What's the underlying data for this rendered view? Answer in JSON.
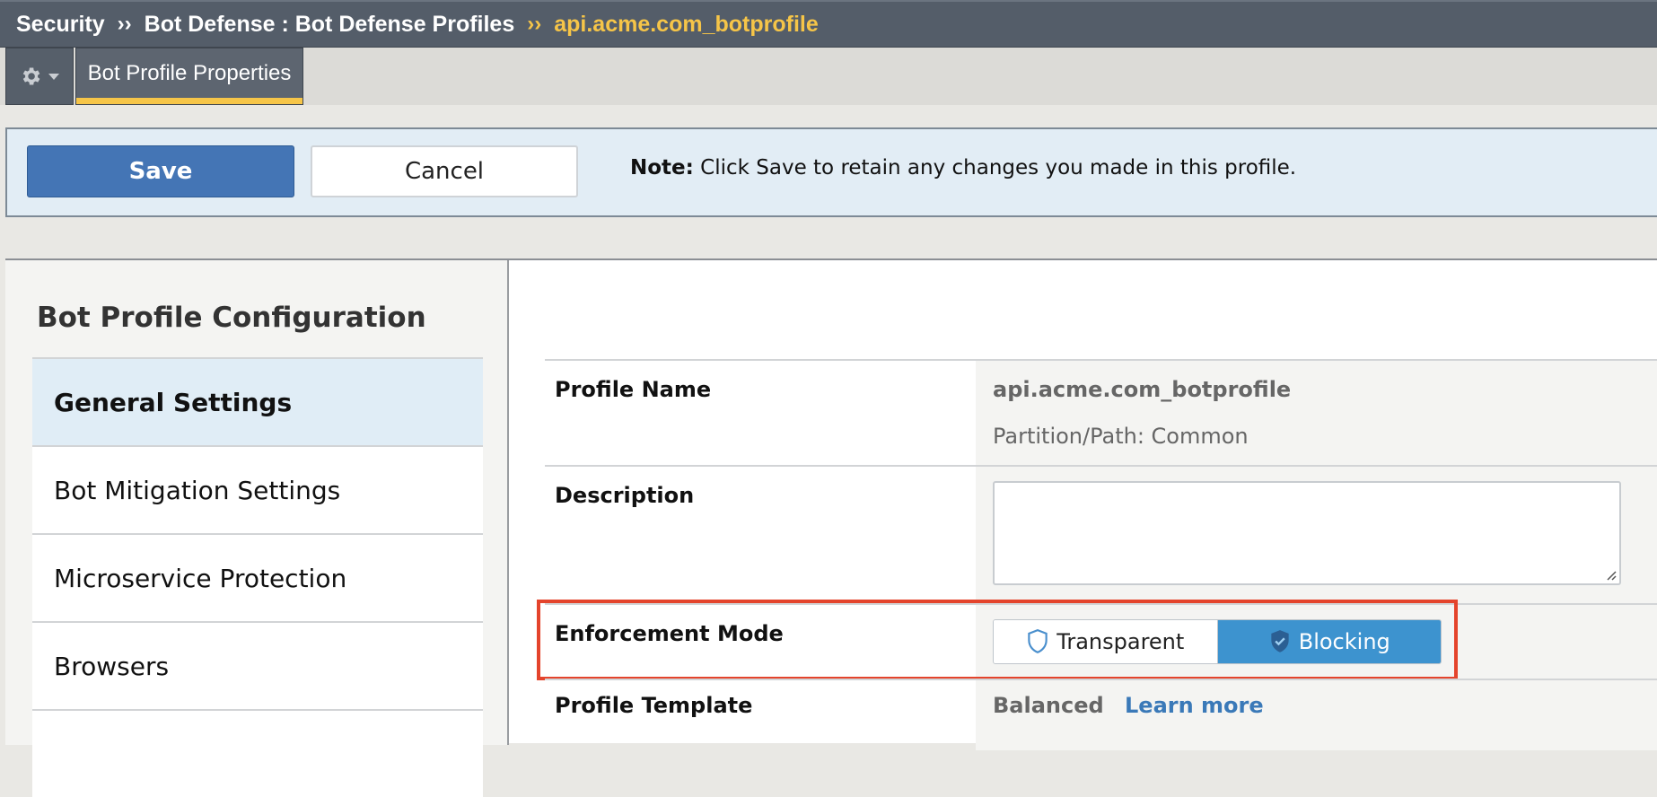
{
  "breadcrumb": {
    "items": [
      "Security",
      "Bot Defense : Bot Defense Profiles"
    ],
    "separator": "››",
    "current": "api.acme.com_botprofile"
  },
  "tabs": {
    "gear_icon": "gear-icon",
    "active_tab": "Bot Profile Properties"
  },
  "actionbar": {
    "save_label": "Save",
    "cancel_label": "Cancel",
    "note_label": "Note:",
    "note_text": " Click Save to retain any changes you made in this profile."
  },
  "sidebar": {
    "title": "Bot Profile Configuration",
    "items": [
      {
        "label": "General Settings",
        "active": true
      },
      {
        "label": "Bot Mitigation Settings"
      },
      {
        "label": "Microservice Protection"
      },
      {
        "label": "Browsers"
      },
      {
        "label": ""
      }
    ]
  },
  "form": {
    "profile_name_label": "Profile Name",
    "profile_name_value": "api.acme.com_botprofile",
    "partition_path": "Partition/Path: Common",
    "description_label": "Description",
    "description_value": "",
    "enforcement_label": "Enforcement Mode",
    "enforcement_options": [
      "Transparent",
      "Blocking"
    ],
    "enforcement_selected": "Blocking",
    "template_label": "Profile Template",
    "template_value": "Balanced",
    "learn_more": "Learn more"
  },
  "colors": {
    "accent_blue": "#4475b5",
    "selected_segment": "#3d93cf",
    "highlight_border": "#e4442c",
    "breadcrumb_current": "#f6c548"
  }
}
